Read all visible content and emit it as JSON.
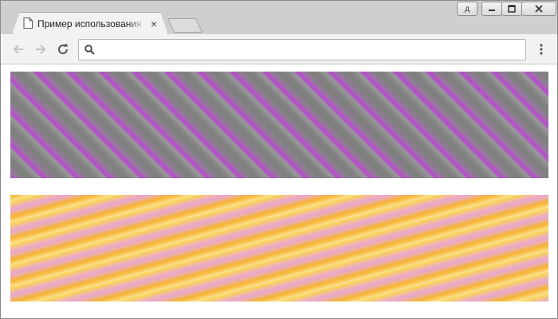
{
  "browser": {
    "tab_title": "Пример использования по",
    "tab_close": "×",
    "user_button_label": "д",
    "omnibox_value": "",
    "omnibox_placeholder": ""
  },
  "icons": {
    "tab": "page-icon",
    "back": "arrow-left-icon",
    "forward": "arrow-right-icon",
    "reload": "reload-icon",
    "search": "search-icon",
    "menu": "more-vert-icon"
  },
  "colors": {
    "stripe1_primary": "#808080",
    "stripe1_accent": "#b154c5",
    "stripe2_primary": "#f5c33a",
    "stripe2_accent": "#e8a6cf"
  }
}
